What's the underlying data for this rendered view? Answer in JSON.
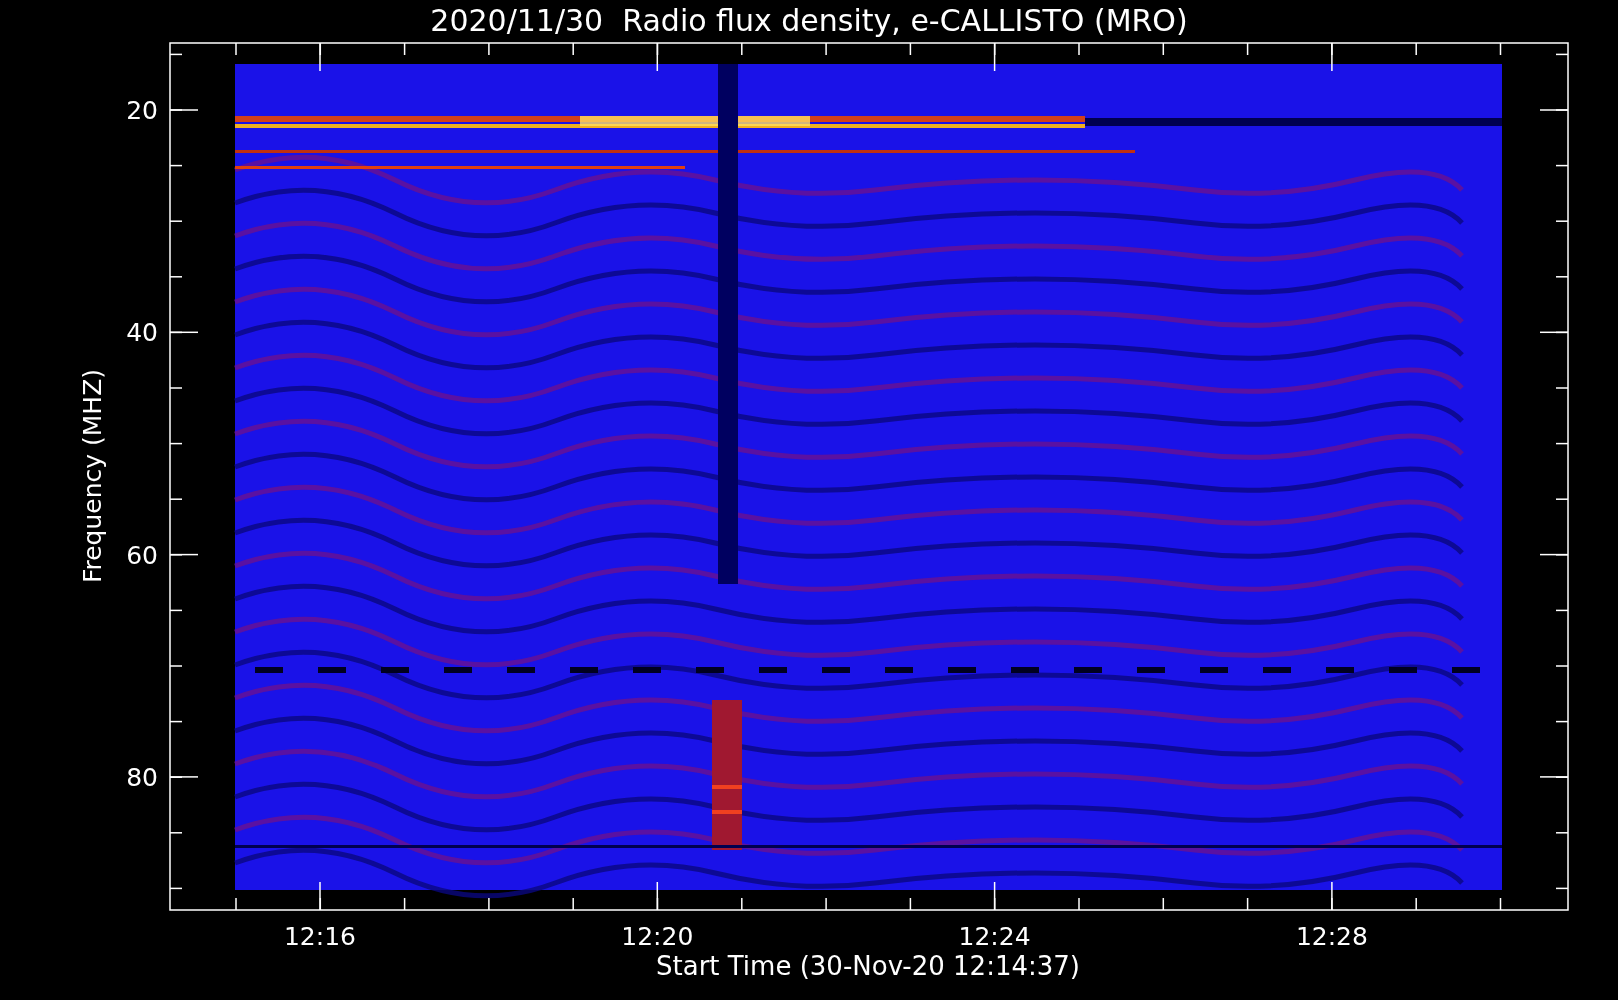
{
  "title": "2020/11/30  Radio flux density, e-CALLISTO (MRO)",
  "y_axis": {
    "label": "Frequency (MHZ)",
    "ticks": [
      "20",
      "40",
      "60",
      "80"
    ]
  },
  "x_axis": {
    "label": "Start Time (30-Nov-20 12:14:37)",
    "ticks": [
      "12:16",
      "12:20",
      "12:24",
      "12:28"
    ]
  }
}
